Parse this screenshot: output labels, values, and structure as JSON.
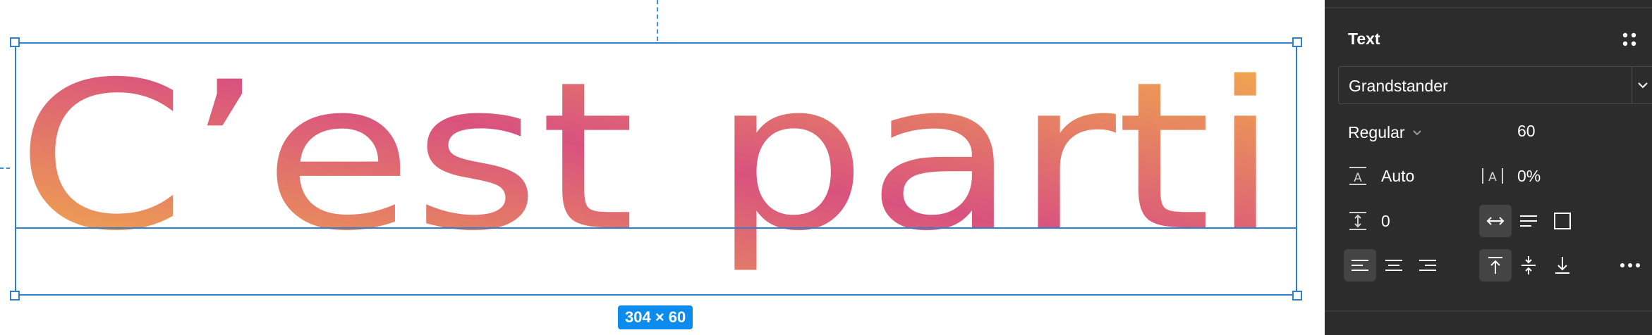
{
  "canvas": {
    "text": "C’est parti",
    "size_badge": "304 × 60",
    "colors": {
      "selection": "#2f80d0",
      "badge": "#0d8cf0",
      "gradient_yellow": "#f3b446",
      "gradient_pink": "#d9527f"
    }
  },
  "panel": {
    "title": "Text",
    "font_family": "Grandstander",
    "font_style": "Regular",
    "font_size": "60",
    "line_height": "Auto",
    "letter_spacing": "0%",
    "paragraph_spacing": "0",
    "icons": [
      "styles-grid-icon",
      "chevron-down-icon",
      "line-height-icon",
      "letter-spacing-icon",
      "paragraph-spacing-icon",
      "auto-width-icon",
      "auto-height-icon",
      "fixed-size-icon",
      "align-left-icon",
      "align-center-icon",
      "align-right-icon",
      "align-top-icon",
      "align-middle-icon",
      "align-bottom-icon",
      "more-icon"
    ],
    "colors": {
      "background": "#2c2c2c",
      "active": "#444444",
      "text": "#ffffff"
    }
  }
}
